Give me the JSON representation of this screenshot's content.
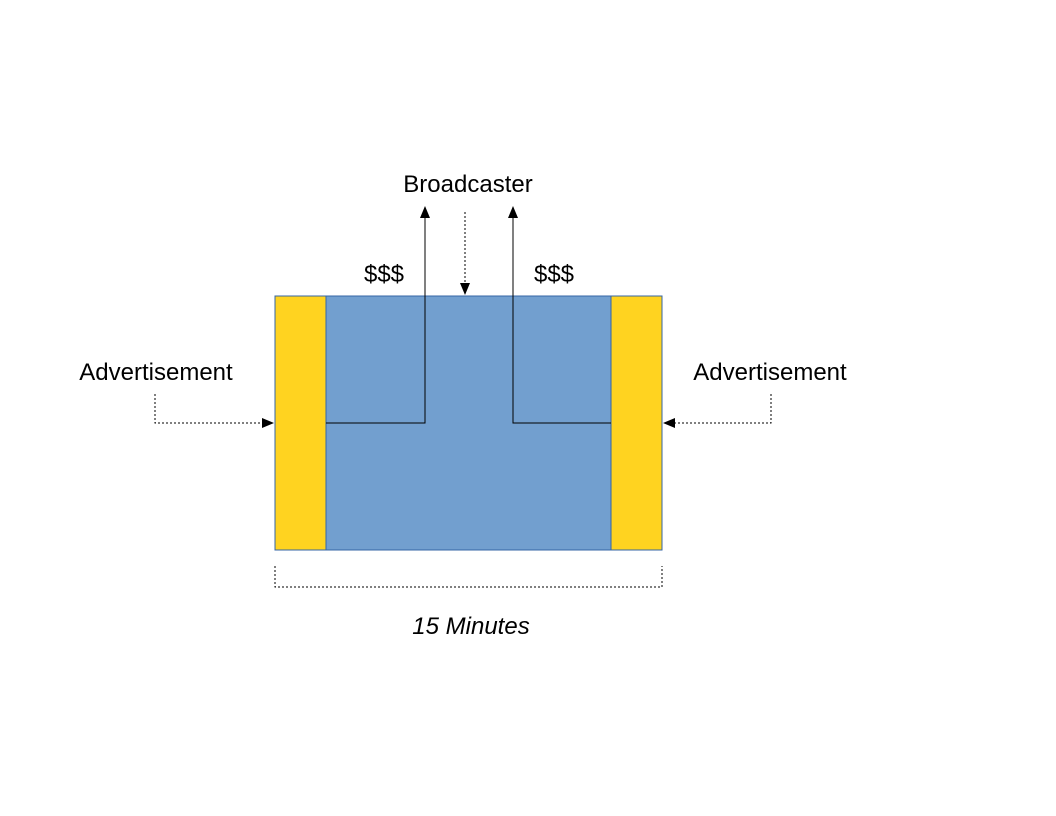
{
  "labels": {
    "broadcaster": "Broadcaster",
    "money_left": "$$$",
    "money_right": "$$$",
    "advertisement_left": "Advertisement",
    "advertisement_right": "Advertisement",
    "duration": "15 Minutes"
  },
  "colors": {
    "program_block": "#729fcf",
    "ad_block": "#ffd320",
    "block_outline": "#3465a4",
    "ink": "#000000"
  }
}
